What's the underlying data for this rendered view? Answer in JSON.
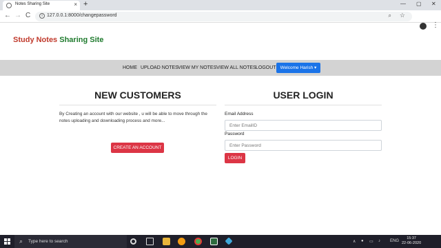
{
  "browser": {
    "tab_title": "Notes Sharing Site",
    "tab_close": "×",
    "new_tab": "+",
    "window_controls": [
      "—",
      "▢",
      "✕"
    ],
    "nav": [
      "←",
      "→",
      "C"
    ],
    "url": "127.0.0.1:8000/changepassword",
    "zoom_glyph": "⌕",
    "star_glyph": "☆",
    "menu_glyph": "⋮"
  },
  "site": {
    "brand_part1": "Study Notes",
    "brand_part2": "Sharing Site",
    "colors": {
      "brand_red": "#c0392b",
      "brand_green": "#1e7a2d",
      "accent_blue": "#1a73e8",
      "button_red": "#dc3545"
    }
  },
  "nav": {
    "links": [
      "HOME",
      "UPLOAD NOTES",
      "VIEW MY NOTES",
      "VIEW ALL NOTES",
      "LOGOUT"
    ],
    "welcome_label": "Welcome Harish ▾"
  },
  "left": {
    "heading": "NEW CUSTOMERS",
    "description": "By Creating an account with our website , u will be able to move through the notes uploading and downloading process and more...",
    "button": "CREATE AN ACCOUNT"
  },
  "login": {
    "heading": "USER LOGIN",
    "email_label": "Email Address",
    "email_placeholder": "Enter EmailID",
    "password_label": "Password",
    "password_placeholder": "Enter Password",
    "button": "LOGIN"
  },
  "taskbar": {
    "search_glyph": "⌕",
    "search_placeholder": "Type here to search",
    "tray_glyphs": [
      "∧",
      "●",
      "▭",
      "♪"
    ],
    "language": "ENG",
    "time": "15:37",
    "date": "22-06-2020"
  }
}
